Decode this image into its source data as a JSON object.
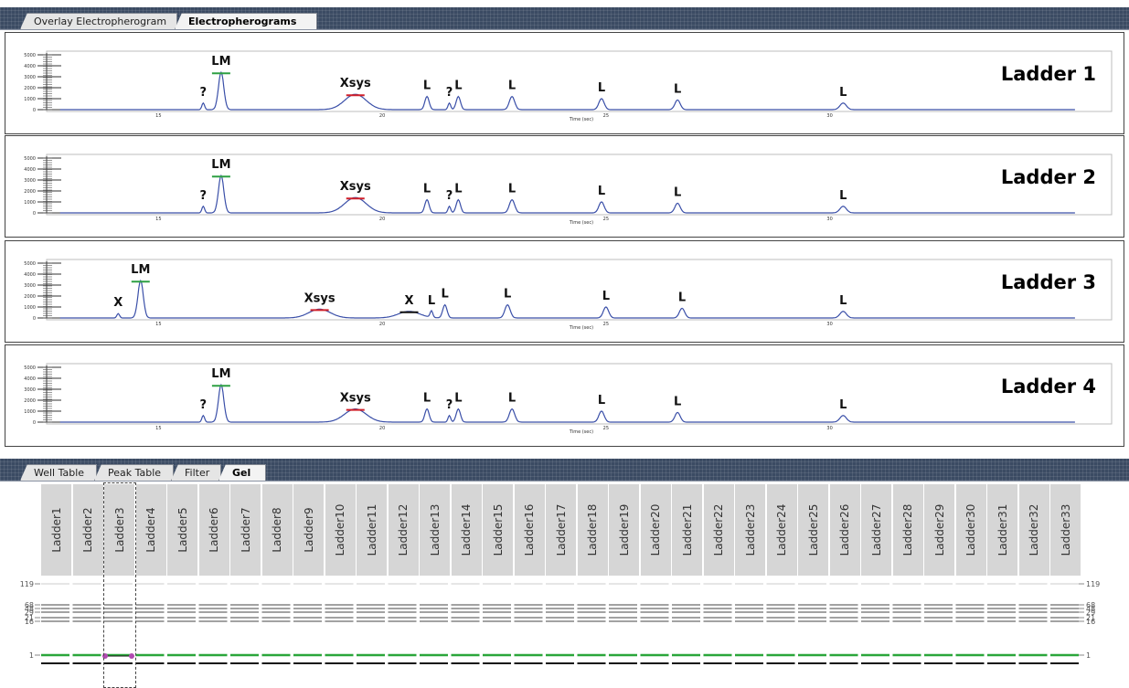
{
  "top_tabs": [
    {
      "label": "Overlay Electropherogram",
      "active": false
    },
    {
      "label": "Electropherograms",
      "active": true
    }
  ],
  "panels": [
    {
      "title": "Ladder 1",
      "y_ticks": [
        "5000",
        "4000",
        "3000",
        "2000",
        "1000",
        "0"
      ],
      "x_ticks": [
        "15",
        "20",
        "25",
        "30"
      ],
      "x_label": "Time (sec)",
      "peaks": [
        {
          "label": "?",
          "time": 16.0,
          "height": 0.15,
          "width": 0.05,
          "mark": ""
        },
        {
          "label": "LM",
          "time": 16.4,
          "height": 0.85,
          "width": 0.1,
          "mark": "green"
        },
        {
          "label": "Xsys",
          "time": 19.4,
          "height": 0.35,
          "width": 0.4,
          "mark": "red"
        },
        {
          "label": "L",
          "time": 21.0,
          "height": 0.3,
          "width": 0.08,
          "mark": ""
        },
        {
          "label": "?",
          "time": 21.5,
          "height": 0.15,
          "width": 0.05,
          "mark": ""
        },
        {
          "label": "L",
          "time": 21.7,
          "height": 0.3,
          "width": 0.08,
          "mark": ""
        },
        {
          "label": "L",
          "time": 22.9,
          "height": 0.3,
          "width": 0.1,
          "mark": ""
        },
        {
          "label": "L",
          "time": 24.9,
          "height": 0.25,
          "width": 0.1,
          "mark": ""
        },
        {
          "label": "L",
          "time": 26.6,
          "height": 0.22,
          "width": 0.1,
          "mark": ""
        },
        {
          "label": "L",
          "time": 30.3,
          "height": 0.15,
          "width": 0.12,
          "mark": ""
        }
      ]
    },
    {
      "title": "Ladder 2",
      "y_ticks": [
        "5000",
        "4000",
        "3000",
        "2000",
        "1000",
        "0"
      ],
      "x_ticks": [
        "15",
        "20",
        "25",
        "30"
      ],
      "x_label": "Time (sec)",
      "peaks": [
        {
          "label": "?",
          "time": 16.0,
          "height": 0.15,
          "width": 0.05,
          "mark": ""
        },
        {
          "label": "LM",
          "time": 16.4,
          "height": 0.85,
          "width": 0.1,
          "mark": "green"
        },
        {
          "label": "Xsys",
          "time": 19.4,
          "height": 0.35,
          "width": 0.4,
          "mark": "red"
        },
        {
          "label": "L",
          "time": 21.0,
          "height": 0.3,
          "width": 0.08,
          "mark": ""
        },
        {
          "label": "?",
          "time": 21.5,
          "height": 0.15,
          "width": 0.05,
          "mark": ""
        },
        {
          "label": "L",
          "time": 21.7,
          "height": 0.3,
          "width": 0.08,
          "mark": ""
        },
        {
          "label": "L",
          "time": 22.9,
          "height": 0.3,
          "width": 0.1,
          "mark": ""
        },
        {
          "label": "L",
          "time": 24.9,
          "height": 0.25,
          "width": 0.1,
          "mark": ""
        },
        {
          "label": "L",
          "time": 26.6,
          "height": 0.22,
          "width": 0.1,
          "mark": ""
        },
        {
          "label": "L",
          "time": 30.3,
          "height": 0.15,
          "width": 0.12,
          "mark": ""
        }
      ]
    },
    {
      "title": "Ladder 3",
      "y_ticks": [
        "5000",
        "4000",
        "3000",
        "2000",
        "1000",
        "0"
      ],
      "x_ticks": [
        "15",
        "20",
        "25",
        "30"
      ],
      "x_label": "Time (sec)",
      "peaks": [
        {
          "label": "X",
          "time": 14.1,
          "height": 0.1,
          "width": 0.05,
          "mark": ""
        },
        {
          "label": "LM",
          "time": 14.6,
          "height": 0.85,
          "width": 0.1,
          "mark": "green"
        },
        {
          "label": "Xsys",
          "time": 18.6,
          "height": 0.2,
          "width": 0.4,
          "mark": "red"
        },
        {
          "label": "X",
          "time": 20.6,
          "height": 0.15,
          "width": 0.4,
          "mark": "black"
        },
        {
          "label": "L",
          "time": 21.1,
          "height": 0.15,
          "width": 0.05,
          "mark": ""
        },
        {
          "label": "L",
          "time": 21.4,
          "height": 0.3,
          "width": 0.08,
          "mark": ""
        },
        {
          "label": "L",
          "time": 22.8,
          "height": 0.3,
          "width": 0.1,
          "mark": ""
        },
        {
          "label": "L",
          "time": 25.0,
          "height": 0.25,
          "width": 0.1,
          "mark": ""
        },
        {
          "label": "L",
          "time": 26.7,
          "height": 0.22,
          "width": 0.1,
          "mark": ""
        },
        {
          "label": "L",
          "time": 30.3,
          "height": 0.15,
          "width": 0.12,
          "mark": ""
        }
      ]
    },
    {
      "title": "Ladder 4",
      "y_ticks": [
        "5000",
        "4000",
        "3000",
        "2000",
        "1000",
        "0"
      ],
      "x_ticks": [
        "15",
        "20",
        "25",
        "30"
      ],
      "x_label": "Time (sec)",
      "peaks": [
        {
          "label": "?",
          "time": 16.0,
          "height": 0.15,
          "width": 0.05,
          "mark": ""
        },
        {
          "label": "LM",
          "time": 16.4,
          "height": 0.85,
          "width": 0.1,
          "mark": "green"
        },
        {
          "label": "Xsys",
          "time": 19.4,
          "height": 0.3,
          "width": 0.4,
          "mark": "red"
        },
        {
          "label": "L",
          "time": 21.0,
          "height": 0.3,
          "width": 0.08,
          "mark": ""
        },
        {
          "label": "?",
          "time": 21.5,
          "height": 0.15,
          "width": 0.05,
          "mark": ""
        },
        {
          "label": "L",
          "time": 21.7,
          "height": 0.3,
          "width": 0.08,
          "mark": ""
        },
        {
          "label": "L",
          "time": 22.9,
          "height": 0.3,
          "width": 0.1,
          "mark": ""
        },
        {
          "label": "L",
          "time": 24.9,
          "height": 0.25,
          "width": 0.1,
          "mark": ""
        },
        {
          "label": "L",
          "time": 26.6,
          "height": 0.22,
          "width": 0.1,
          "mark": ""
        },
        {
          "label": "L",
          "time": 30.3,
          "height": 0.15,
          "width": 0.12,
          "mark": ""
        }
      ]
    }
  ],
  "bottom_tabs": [
    {
      "label": "Well Table",
      "active": false
    },
    {
      "label": "Peak Table",
      "active": false
    },
    {
      "label": "Filter",
      "active": false
    },
    {
      "label": "Gel",
      "active": true
    }
  ],
  "gel": {
    "lanes": [
      "Ladder1",
      "Ladder2",
      "Ladder3",
      "Ladder4",
      "Ladder5",
      "Ladder6",
      "Ladder7",
      "Ladder8",
      "Ladder9",
      "Ladder10",
      "Ladder11",
      "Ladder12",
      "Ladder13",
      "Ladder14",
      "Ladder15",
      "Ladder16",
      "Ladder17",
      "Ladder18",
      "Ladder19",
      "Ladder20",
      "Ladder21",
      "Ladder22",
      "Ladder23",
      "Ladder24",
      "Ladder25",
      "Ladder26",
      "Ladder27",
      "Ladder28",
      "Ladder29",
      "Ladder30",
      "Ladder31",
      "Ladder32",
      "Ladder33"
    ],
    "selected_lane": "Ladder3",
    "size_markers_left": [
      "119",
      "68",
      "48",
      "29",
      "21",
      "16",
      "1"
    ],
    "size_markers_right": [
      "119",
      "68",
      "48",
      "29",
      "21",
      "16",
      "1"
    ]
  },
  "colors": {
    "trace": "#3a4fa8",
    "lower_marker": "#2ea043",
    "system_peak": "#d0202a",
    "gel_band": "#111111",
    "gel_band_light": "#999999",
    "gel_marker_band": "#2aa63a",
    "tab_strip": "#3b4b63",
    "lane_header": "#d6d6d6",
    "selection_marker": "#b04ab0"
  }
}
